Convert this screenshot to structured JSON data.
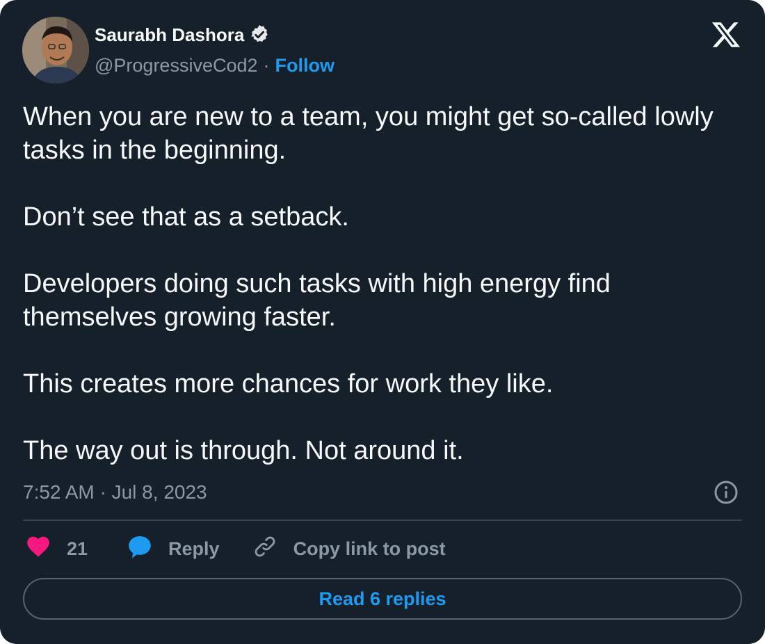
{
  "author": {
    "name": "Saurabh Dashora",
    "handle": "@ProgressiveCod2",
    "separator": "·",
    "follow_label": "Follow",
    "verified_icon": "verified-badge-icon"
  },
  "tweet": {
    "paragraphs": [
      "When you are new to a team, you might get so-called lowly tasks in the beginning.",
      "Don’t see that as a setback.",
      "Developers doing such tasks with high energy find themselves growing faster.",
      "This creates more chances for work they like.",
      "The way out is through. Not around it."
    ],
    "timestamp": "7:52 AM · Jul 8, 2023"
  },
  "actions": {
    "like_count": "21",
    "reply_label": "Reply",
    "copy_link_label": "Copy link to post"
  },
  "read_replies_label": "Read 6 replies",
  "colors": {
    "background": "#15202b",
    "text": "#f7f9f9",
    "muted": "#8b98a5",
    "accent": "#1d9bf0",
    "like": "#f91880",
    "divider": "#38444d"
  },
  "icons": [
    "x-logo-icon",
    "info-icon",
    "heart-icon",
    "reply-bubble-icon",
    "link-icon"
  ]
}
